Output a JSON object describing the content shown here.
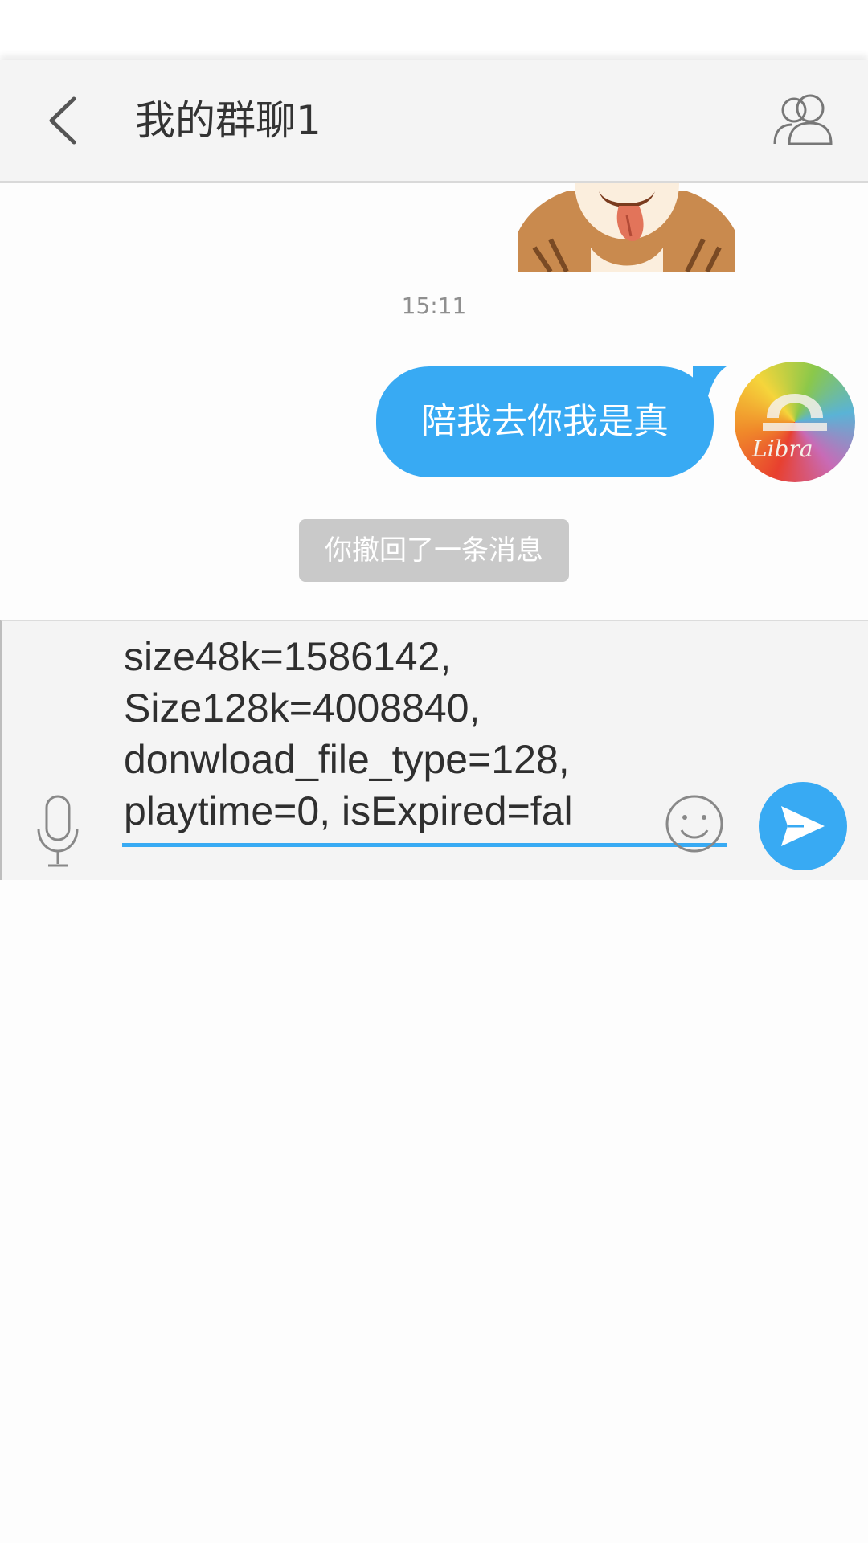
{
  "header": {
    "title": "我的群聊1",
    "back_icon": "chevron-left-icon",
    "members_icon": "group-members-icon"
  },
  "chat": {
    "sticker_icon": "cat-sticker",
    "timestamp": "15:11",
    "messages": [
      {
        "text": "陪我去你我是真",
        "bubble_color": "#38aaf3",
        "avatar_label": "Libra"
      }
    ],
    "recall_notice": "你撤回了一条消息"
  },
  "input_bar": {
    "mic_icon": "microphone-icon",
    "text": "size48k=1586142,\nSize128k=4008840,\ndonwload_file_type=128,\nplaytime=0, isExpired=fal",
    "emoji_icon": "smiley-icon",
    "send_icon": "send-icon",
    "accent": "#38aaf3"
  }
}
